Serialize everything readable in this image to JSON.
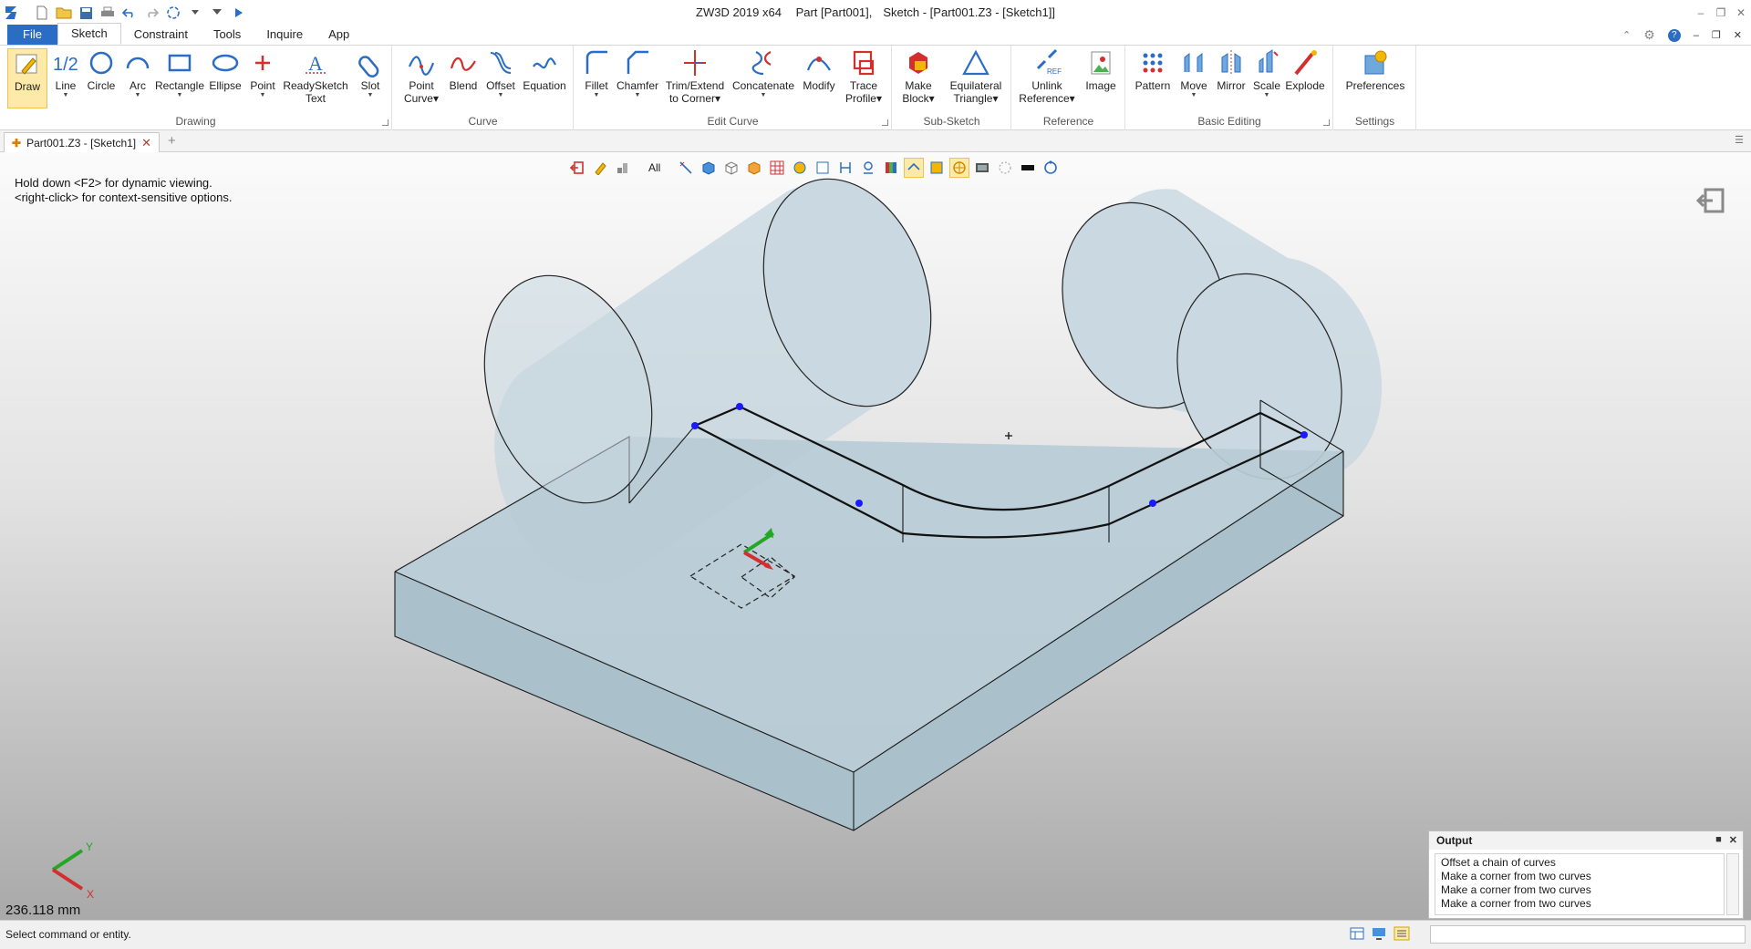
{
  "app": {
    "title_app": "ZW3D 2019  x64",
    "title_part": "Part [Part001],",
    "title_sketch": "Sketch - [Part001.Z3 - [Sketch1]]"
  },
  "ribbon_tabs": [
    "File",
    "Sketch",
    "Constraint",
    "Tools",
    "Inquire",
    "App"
  ],
  "groups": {
    "drawing": "Drawing",
    "curve": "Curve",
    "edit_curve": "Edit Curve",
    "sub_sketch": "Sub-Sketch",
    "reference": "Reference",
    "basic_editing": "Basic Editing",
    "settings": "Settings"
  },
  "tools": {
    "draw": "Draw",
    "line": "Line",
    "circle": "Circle",
    "arc": "Arc",
    "rectangle": "Rectangle",
    "ellipse": "Ellipse",
    "point": "Point",
    "readysketch_1": "ReadySketch",
    "readysketch_2": "Text",
    "slot": "Slot",
    "point_curve_1": "Point",
    "point_curve_2": "Curve",
    "blend": "Blend",
    "offset": "Offset",
    "equation": "Equation",
    "fillet": "Fillet",
    "chamfer": "Chamfer",
    "trim_1": "Trim/Extend",
    "trim_2": "to Corner",
    "concatenate": "Concatenate",
    "modify": "Modify",
    "trace_1": "Trace",
    "trace_2": "Profile",
    "make_block_1": "Make",
    "make_block_2": "Block",
    "equi_1": "Equilateral",
    "equi_2": "Triangle",
    "unlink_1": "Unlink",
    "unlink_2": "Reference",
    "image": "Image",
    "pattern": "Pattern",
    "move": "Move",
    "mirror": "Mirror",
    "scale": "Scale",
    "explode": "Explode",
    "preferences": "Preferences"
  },
  "doc_tab": {
    "label": "Part001.Z3 - [Sketch1]"
  },
  "viewport": {
    "hint_1": "Hold down <F2> for dynamic viewing.",
    "hint_2": "<right-click> for context-sensitive options.",
    "filter": "All",
    "measure": "236.118 mm",
    "axis_x": "X",
    "axis_y": "Y"
  },
  "output": {
    "title": "Output",
    "lines": [
      "Offset a chain of curves",
      "Make a corner from two curves",
      "Make a corner from two curves",
      "Make a corner from two curves"
    ]
  },
  "status": {
    "text": "Select command or entity."
  },
  "colors": {
    "accent": "#2b6cc4",
    "selected": "#fde9a8",
    "sketch_point": "#1a1aff",
    "solid_fill": "#c3d3db"
  }
}
